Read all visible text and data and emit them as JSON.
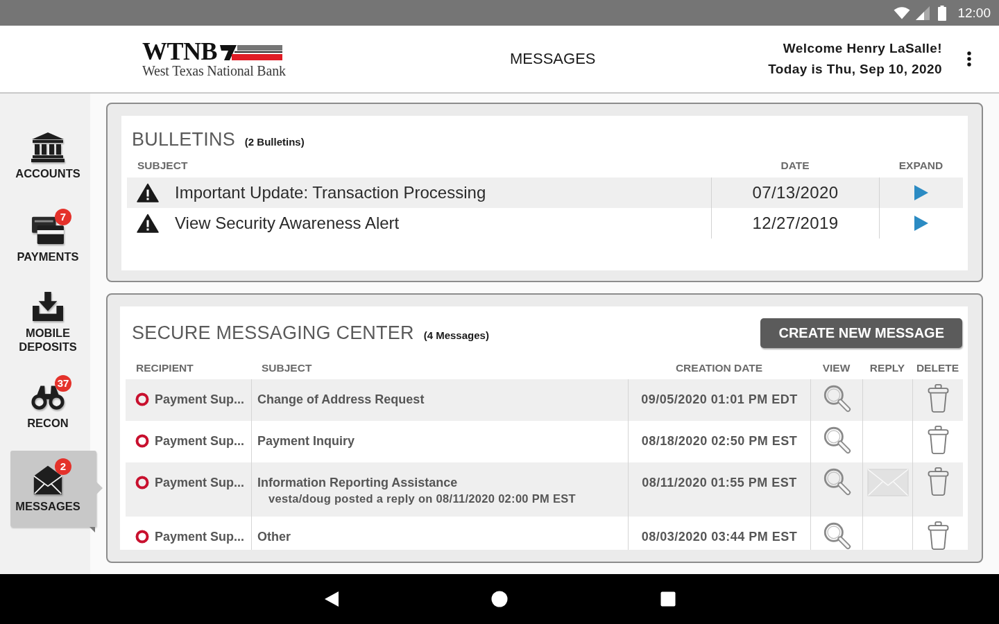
{
  "status_bar": {
    "time": "12:00"
  },
  "header": {
    "logo_text": "WTNB",
    "logo_subtitle": "West Texas National Bank",
    "title": "MESSAGES",
    "welcome": "Welcome Henry LaSalle!",
    "date_line": "Today is Thu, Sep 10, 2020"
  },
  "sidebar": {
    "items": [
      {
        "label": "ACCOUNTS",
        "selected": false
      },
      {
        "label": "PAYMENTS",
        "badge": "7",
        "selected": false
      },
      {
        "label": "MOBILE DEPOSITS",
        "selected": false
      },
      {
        "label": "RECON",
        "badge": "37",
        "selected": false
      },
      {
        "label": "MESSAGES",
        "badge": "2",
        "selected": true
      }
    ]
  },
  "bulletins": {
    "title": "BULLETINS",
    "count": "(2 Bulletins)",
    "columns": [
      "SUBJECT",
      "DATE",
      "EXPAND"
    ],
    "rows": [
      {
        "subject": "Important Update: Transaction Processing",
        "date": "07/13/2020"
      },
      {
        "subject": "View Security Awareness Alert",
        "date": "12/27/2019"
      }
    ]
  },
  "messaging": {
    "title": "SECURE MESSAGING CENTER",
    "count": "(4 Messages)",
    "create_button": "CREATE NEW MESSAGE",
    "columns": [
      "RECIPIENT",
      "SUBJECT",
      "CREATION DATE",
      "VIEW",
      "REPLY",
      "DELETE"
    ],
    "rows": [
      {
        "recipient": "Payment Sup...",
        "unread": true,
        "subject": "Change of Address Request",
        "created": "09/05/2020 01:01 PM EDT",
        "can_reply": false
      },
      {
        "recipient": "Payment Sup...",
        "unread": true,
        "subject": "Payment Inquiry",
        "created": "08/18/2020 02:50 PM EST",
        "can_reply": false
      },
      {
        "recipient": "Payment Sup...",
        "unread": true,
        "subject": "Information Reporting Assistance",
        "reply_note": "vesta/doug posted a reply on 08/11/2020 02:00 PM EST",
        "created": "08/11/2020 01:55 PM EST",
        "can_reply": true
      },
      {
        "recipient": "Payment Sup...",
        "unread": true,
        "subject": "Other",
        "created": "08/03/2020 03:44 PM EST",
        "can_reply": false
      }
    ]
  }
}
